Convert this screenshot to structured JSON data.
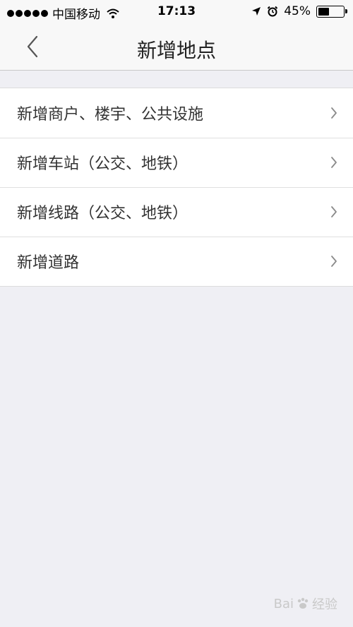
{
  "status_bar": {
    "carrier": "中国移动",
    "time": "17:13",
    "battery_text": "45%",
    "battery_level": 0.45
  },
  "nav": {
    "title": "新增地点",
    "back_icon": "chevron-left-icon"
  },
  "list": {
    "items": [
      {
        "label": "新增商户、楼宇、公共设施"
      },
      {
        "label": "新增车站（公交、地铁）"
      },
      {
        "label": "新增线路（公交、地铁）"
      },
      {
        "label": "新增道路"
      }
    ]
  },
  "watermark": {
    "text_1": "Bai",
    "text_2": "经验"
  },
  "colors": {
    "background": "#efeff4",
    "nav_bg": "#f8f8f8",
    "text": "#333333",
    "chevron": "#b0b0b0"
  }
}
